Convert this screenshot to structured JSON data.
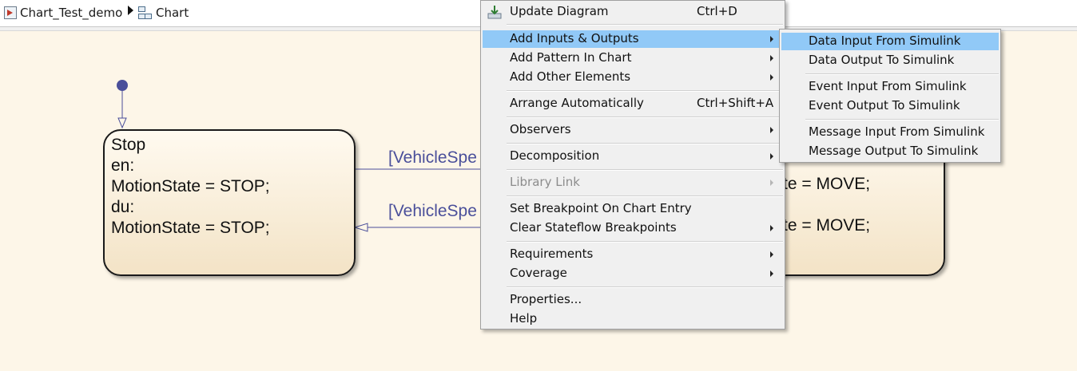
{
  "breadcrumb": {
    "items": [
      {
        "label": "Chart_Test_demo",
        "icon": "simulink-model-icon"
      },
      {
        "label": "Chart",
        "icon": "stateflow-chart-icon"
      }
    ],
    "separator_icon": "triangle-right-icon"
  },
  "diagram": {
    "stop_state": {
      "lines": [
        "Stop",
        "en:",
        "MotionState = STOP;",
        "du:",
        "MotionState = STOP;"
      ]
    },
    "move_state_fragments": [
      "te = MOVE;",
      "te = MOVE;"
    ],
    "transitions": [
      "[VehicleSpe",
      "[VehicleSpe"
    ]
  },
  "context_menu": {
    "items": [
      {
        "label": "Update Diagram",
        "shortcut": "Ctrl+D",
        "icon": "update-diagram-icon"
      },
      {
        "label": "Add Inputs & Outputs",
        "submenu": true,
        "highlighted": true
      },
      {
        "label": "Add Pattern In Chart",
        "submenu": true
      },
      {
        "label": "Add Other Elements",
        "submenu": true
      },
      {
        "label": "Arrange Automatically",
        "shortcut": "Ctrl+Shift+A"
      },
      {
        "label": "Observers",
        "submenu": true
      },
      {
        "label": "Decomposition",
        "submenu": true
      },
      {
        "label": "Library Link",
        "submenu": true,
        "disabled": true
      },
      {
        "label": "Set Breakpoint On Chart Entry"
      },
      {
        "label": "Clear Stateflow Breakpoints",
        "submenu": true
      },
      {
        "label": "Requirements",
        "submenu": true
      },
      {
        "label": "Coverage",
        "submenu": true
      },
      {
        "label": "Properties..."
      },
      {
        "label": "Help"
      }
    ]
  },
  "submenu": {
    "items": [
      {
        "label": "Data Input From Simulink",
        "highlighted": true
      },
      {
        "label": "Data Output To Simulink"
      },
      {
        "label": "Event Input From Simulink"
      },
      {
        "label": "Event Output To Simulink"
      },
      {
        "label": "Message Input From Simulink"
      },
      {
        "label": "Message Output To Simulink"
      }
    ]
  },
  "colors": {
    "canvas": "#fdf6e8",
    "highlight": "#91c9f7",
    "transition_text": "#4a4f9a",
    "default_transition_dot": "#4a4f9a"
  }
}
